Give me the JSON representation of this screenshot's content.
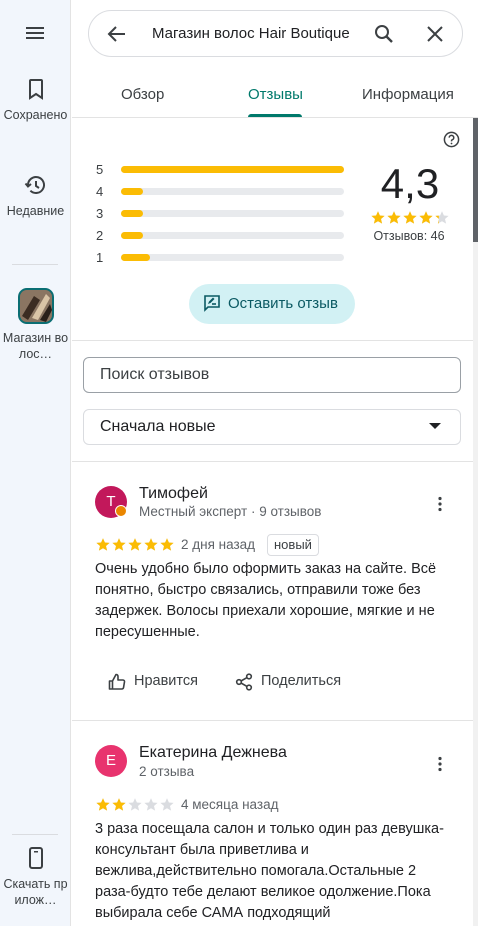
{
  "rail": {
    "saved_label": "Сохранено",
    "recent_label": "Недавние",
    "place_label": "Магазин волос…",
    "download_label": "Скачать прилож…"
  },
  "search": {
    "query": "Магазин волос Hair Boutique"
  },
  "tabs": [
    {
      "label": "Обзор"
    },
    {
      "label": "Отзывы"
    },
    {
      "label": "Информация"
    }
  ],
  "rating": {
    "value": "4,3",
    "stars": 4.3,
    "reviews_count": "Отзывов: 46",
    "distribution": [
      {
        "stars": "5",
        "fraction": 1.0
      },
      {
        "stars": "4",
        "fraction": 0.1
      },
      {
        "stars": "3",
        "fraction": 0.1
      },
      {
        "stars": "2",
        "fraction": 0.1
      },
      {
        "stars": "1",
        "fraction": 0.13
      }
    ],
    "write_review_label": "Оставить отзыв"
  },
  "filters": {
    "search_placeholder": "Поиск отзывов",
    "sort_label": "Сначала новые"
  },
  "reviews": [
    {
      "avatar_letter": "Т",
      "avatar_color": "#c2185b",
      "name": "Тимофей",
      "subtitle": "Местный эксперт · 9 отзывов",
      "stars": 5,
      "date": "2 дня назад",
      "badge": "новый",
      "text": [
        "Очень удобно было оформить заказ на сайте. Всё",
        "понятно, быстро связались, отправили тоже без",
        "задержек. Волосы приехали хорошие, мягкие и не",
        "пересушенные."
      ],
      "like_label": "Нравится",
      "share_label": "Поделиться"
    },
    {
      "avatar_letter": "Е",
      "avatar_color": "#e8336e",
      "name": "Екатерина Дежнева",
      "subtitle": "2 отзыва",
      "stars": 2,
      "date": "4 месяца назад",
      "text": [
        "3 раза посещала салон и только один раз девушка-",
        "консультант была приветлива и",
        "вежлива,действительно помогала.Остальные 2",
        "раза-будто тебе делают великое одолжение.Пока",
        "выбирала себе САМА подходящий"
      ]
    }
  ],
  "colors": {
    "accent": "#00796b",
    "star": "#fbbc04",
    "star_empty": "#dadce0"
  }
}
